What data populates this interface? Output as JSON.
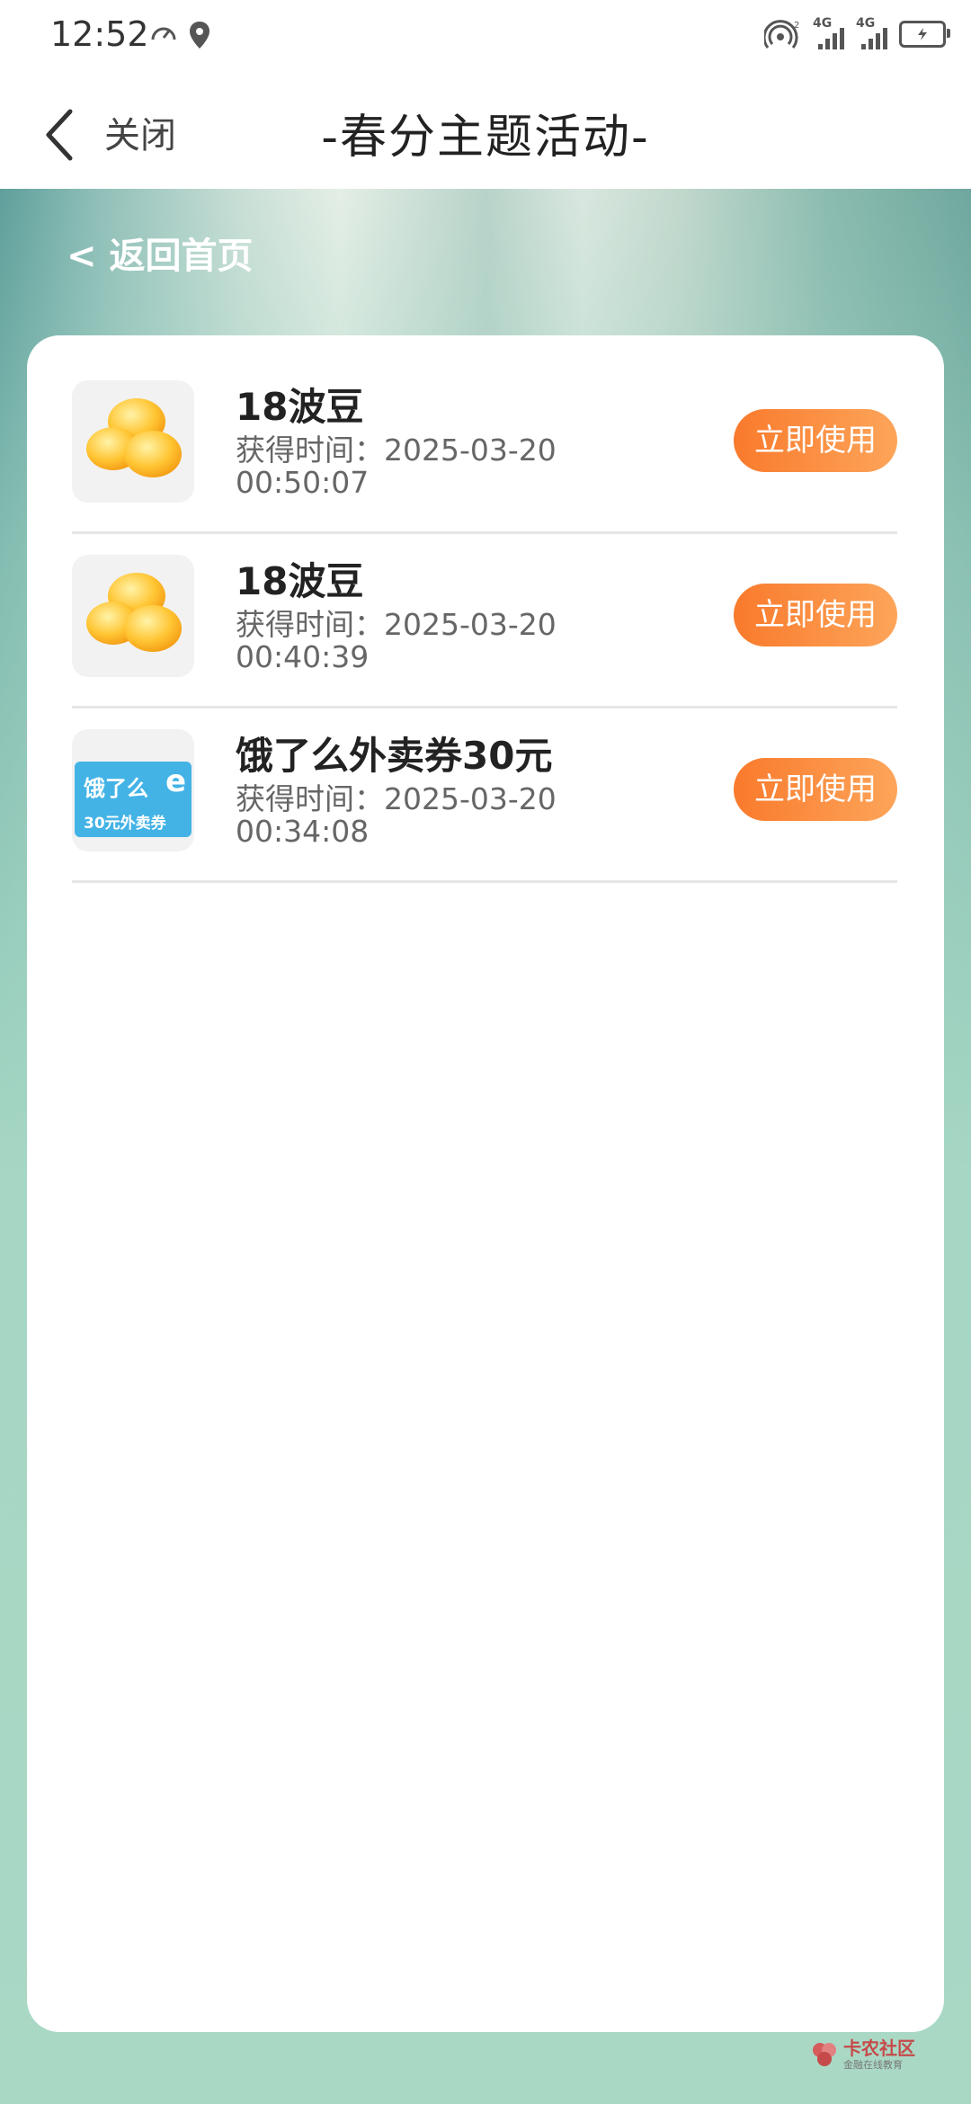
{
  "status_bar": {
    "time": "12:52",
    "network_labels": [
      "4G",
      "4G"
    ],
    "sim_index": "2",
    "icons": [
      "speed-icon",
      "location-icon",
      "hotspot-icon",
      "signal-icon",
      "battery-icon"
    ]
  },
  "nav": {
    "close_label": "关闭",
    "title": "-春分主题活动-"
  },
  "back_home_label": "< 返回首页",
  "records": [
    {
      "title": "18波豆",
      "time_label": "获得时间：2025-03-20 00:50:07",
      "button": "立即使用",
      "icon": "beans-icon"
    },
    {
      "title": "18波豆",
      "time_label": "获得时间：2025-03-20 00:40:39",
      "button": "立即使用",
      "icon": "beans-icon"
    },
    {
      "title": "饿了么外卖券30元",
      "time_label": "获得时间：2025-03-20 00:34:08",
      "button": "立即使用",
      "icon": "eleme-coupon-icon",
      "icon_text": {
        "brand": "饿了么",
        "sub": "30元外卖券"
      }
    }
  ],
  "watermark": {
    "title": "卡农社区",
    "subtitle": "金融在线教育"
  },
  "colors": {
    "button_start": "#f97a2c",
    "button_end": "#fda55a",
    "bg_green": "#a9d8c5"
  }
}
